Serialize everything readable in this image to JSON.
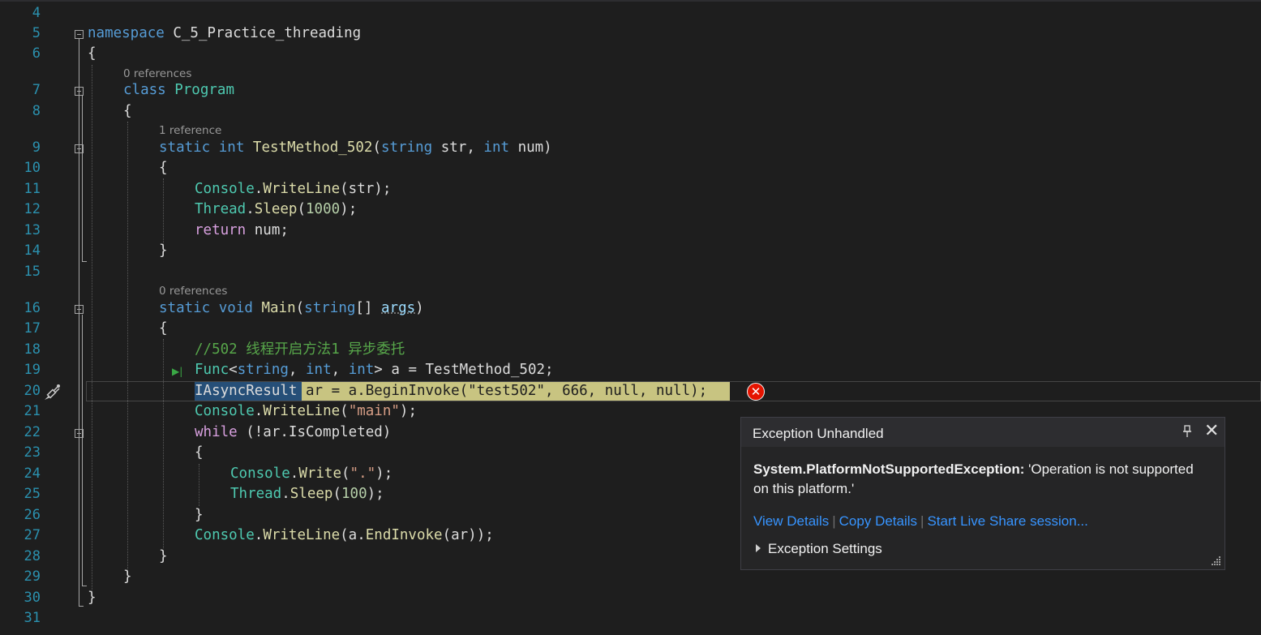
{
  "editor": {
    "line_numbers": [
      "4",
      "5",
      "6",
      "7",
      "8",
      "9",
      "10",
      "11",
      "12",
      "13",
      "14",
      "15",
      "16",
      "17",
      "18",
      "19",
      "20",
      "21",
      "22",
      "23",
      "24",
      "25",
      "26",
      "27",
      "28",
      "29",
      "30",
      "31"
    ],
    "codelens": {
      "class_program": "0 references",
      "test_method": "1 reference",
      "main": "0 references"
    },
    "lines": {
      "l5_kw": "namespace",
      "l5_rest": " C_5_Practice_threading",
      "l6": "{",
      "l7_kw": "class",
      "l7_ty": "Program",
      "l8": "{",
      "l9_kw1": "static",
      "l9_kw2": "int",
      "l9_mt": "TestMethod_502",
      "l9_p1": "(",
      "l9_kw3": "string",
      "l9_p2": " str, ",
      "l9_kw4": "int",
      "l9_p3": " num)",
      "l10": "{",
      "l11_ty": "Console",
      "l11_p1": ".",
      "l11_mt": "WriteLine",
      "l11_p2": "(str);",
      "l12_ty": "Thread",
      "l12_p1": ".",
      "l12_mt": "Sleep",
      "l12_p2": "(",
      "l12_num": "1000",
      "l12_p3": ");",
      "l13_kw": "return",
      "l13_p": " num;",
      "l14": "}",
      "l16_kw1": "static",
      "l16_kw2": "void",
      "l16_mt": "Main",
      "l16_p1": "(",
      "l16_kw3": "string",
      "l16_p2": "[] ",
      "l16_id": "args",
      "l16_p3": ")",
      "l17": "{",
      "l18_cm": "//502 线程开启方法1 异步委托",
      "l19_ty": "Func",
      "l19_p1": "<",
      "l19_kw1": "string",
      "l19_p2": ", ",
      "l19_kw2": "int",
      "l19_p3": ", ",
      "l19_kw3": "int",
      "l19_p4": "> a = TestMethod_502;",
      "l20_ty": "IAsyncResult",
      "l20_p1": " ar = a.BeginInvoke(",
      "l20_s": "\"test502\"",
      "l20_p2": ", ",
      "l20_n": "666",
      "l20_p3": ", ",
      "l20_k1": "null",
      "l20_p4": ", ",
      "l20_k2": "null",
      "l20_p5": ");",
      "l21_ty": "Console",
      "l21_p1": ".",
      "l21_mt": "WriteLine",
      "l21_p2": "(",
      "l21_s": "\"main\"",
      "l21_p3": ");",
      "l22_kw": "while",
      "l22_p": " (!ar.IsCompleted)",
      "l23": "{",
      "l24_ty": "Console",
      "l24_p1": ".",
      "l24_mt": "Write",
      "l24_p2": "(",
      "l24_s": "\".\"",
      "l24_p3": ");",
      "l25_ty": "Thread",
      "l25_p1": ".",
      "l25_mt": "Sleep",
      "l25_p2": "(",
      "l25_n": "100",
      "l25_p3": ");",
      "l26": "}",
      "l27_ty": "Console",
      "l27_p1": ".",
      "l27_mt": "WriteLine",
      "l27_p2": "(a.",
      "l27_mt2": "EndInvoke",
      "l27_p3": "(ar));",
      "l28": "}",
      "l29": "}",
      "l30": "}"
    }
  },
  "exception": {
    "title": "Exception Unhandled",
    "type": "System.PlatformNotSupportedException:",
    "message": " 'Operation is not supported on this platform.'",
    "links": {
      "view_details": "View Details",
      "copy_details": "Copy Details",
      "live_share": "Start Live Share session..."
    },
    "sep": "|",
    "settings": "Exception Settings",
    "error_glyph": "✕",
    "pin_glyph": "🖈",
    "close_glyph": "✕"
  },
  "colors": {
    "background": "#1e1e1e",
    "keyword": "#569cd6",
    "type": "#4ec9b0",
    "method": "#dcdcaa",
    "string": "#d69d85",
    "number": "#b5cea8",
    "comment": "#57a64a",
    "line_number": "#2b91af",
    "statement_highlight": "#c8c481",
    "link": "#3794ff",
    "error": "#e51400"
  },
  "icons": {
    "fold": "collapse-box-icon",
    "error": "error-circle-icon",
    "exec": "execution-arrow-icon",
    "brush": "paintbrush-icon",
    "pin": "pin-icon",
    "close": "close-icon",
    "grip": "resize-grip-icon",
    "expand": "expand-triangle-icon"
  }
}
